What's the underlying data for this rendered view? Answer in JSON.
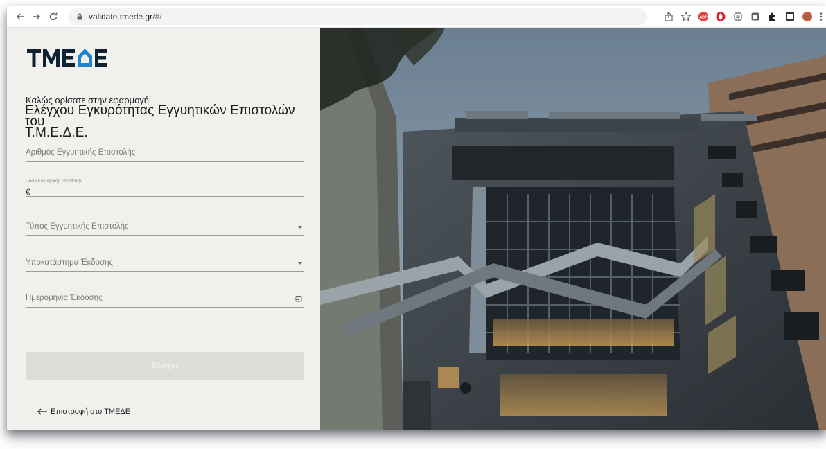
{
  "browser": {
    "url_host": "validate.tmede.gr",
    "url_path": "/#/"
  },
  "logo": {
    "text": "ΤΜΕΔΕ"
  },
  "welcome": {
    "line1": "Καλώς ορίσατε στην εφαρμογή",
    "line2": "Ελέγχου Εγκυρότητας Εγγυητικών Επιστολών του",
    "line3": "Τ.Μ.Ε.Δ.Ε."
  },
  "form": {
    "letter_number": {
      "placeholder": "Αριθμός Εγγυητικής Επιστολής"
    },
    "amount": {
      "label": "Ποσό Εγγυητικής Επιστολής",
      "value": "€"
    },
    "letter_type": {
      "placeholder": "Τύπος Εγγυητικής Επιστολής"
    },
    "branch": {
      "placeholder": "Υποκατάστημα Έκδοσης"
    },
    "issue_date": {
      "placeholder": "Ημερομηνία Έκδοσης"
    },
    "submit_label": "Έλεγχος"
  },
  "back_link": "Επιστροφή στο ΤΜΕΔΕ",
  "colors": {
    "panel_bg": "#f1f0ec",
    "logo_dark": "#0f2233",
    "logo_accent": "#1f86c9",
    "button_disabled": "#dddcd8"
  },
  "icons": [
    "back-icon",
    "forward-icon",
    "reload-icon",
    "lock-icon",
    "share-icon",
    "star-icon",
    "adblock-icon",
    "opera-icon",
    "reading-list-icon",
    "extension-icon",
    "puzzle-icon",
    "sidepanel-icon",
    "profile-icon",
    "menu-icon",
    "caret-down-icon",
    "calendar-icon",
    "arrow-left-icon"
  ]
}
